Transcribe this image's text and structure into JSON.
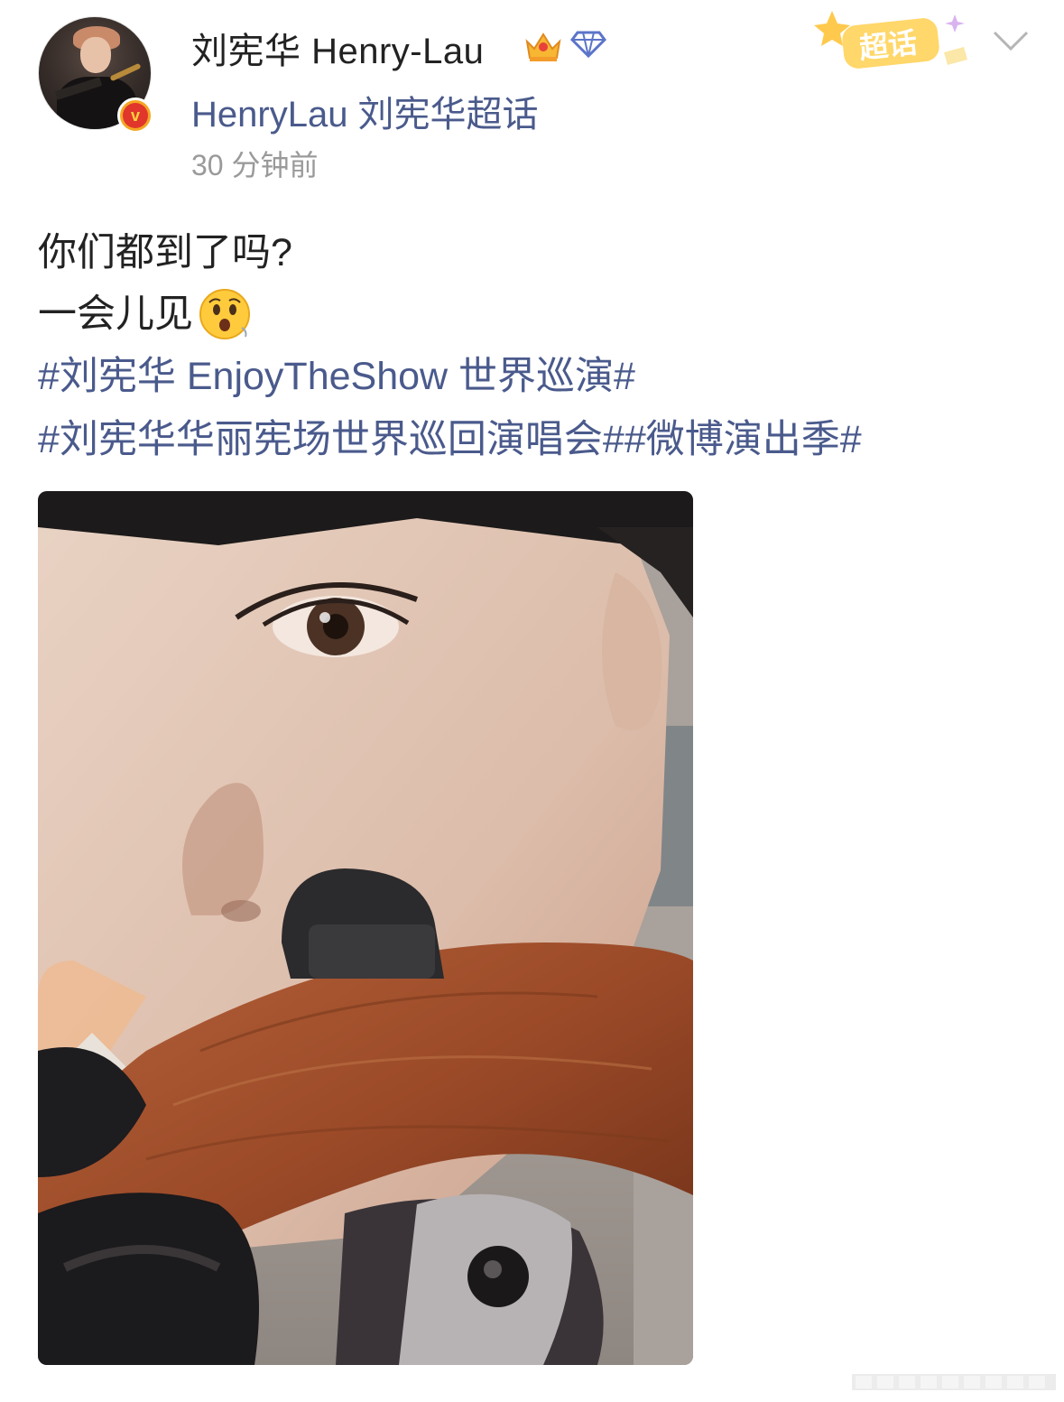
{
  "post": {
    "author": {
      "name": "刘宪华 Henry-Lau",
      "verified": true,
      "avatar_icon": "avatar-photo",
      "badges": [
        "crown-icon",
        "diamond-icon"
      ]
    },
    "supertopic_link": "HenryLau 刘宪华超话",
    "timestamp": "30 分钟前",
    "supertopic_badge_label": "超话",
    "menu_icon": "chevron-down-icon",
    "text_lines": [
      "你们都到了吗?",
      "一会儿见"
    ],
    "emoji": "surprised-face-emoji",
    "hashtags": [
      "#刘宪华 EnjoyTheShow 世界巡演#",
      "#刘宪华华丽宪场世界巡回演唱会##微博演出季#"
    ],
    "image_description_icon": "post-photo"
  },
  "colors": {
    "link": "#4a5a8c",
    "text": "#222222",
    "muted": "#9a9a9a",
    "badge_orange": "#f5a623",
    "badge_red": "#e0362c"
  }
}
